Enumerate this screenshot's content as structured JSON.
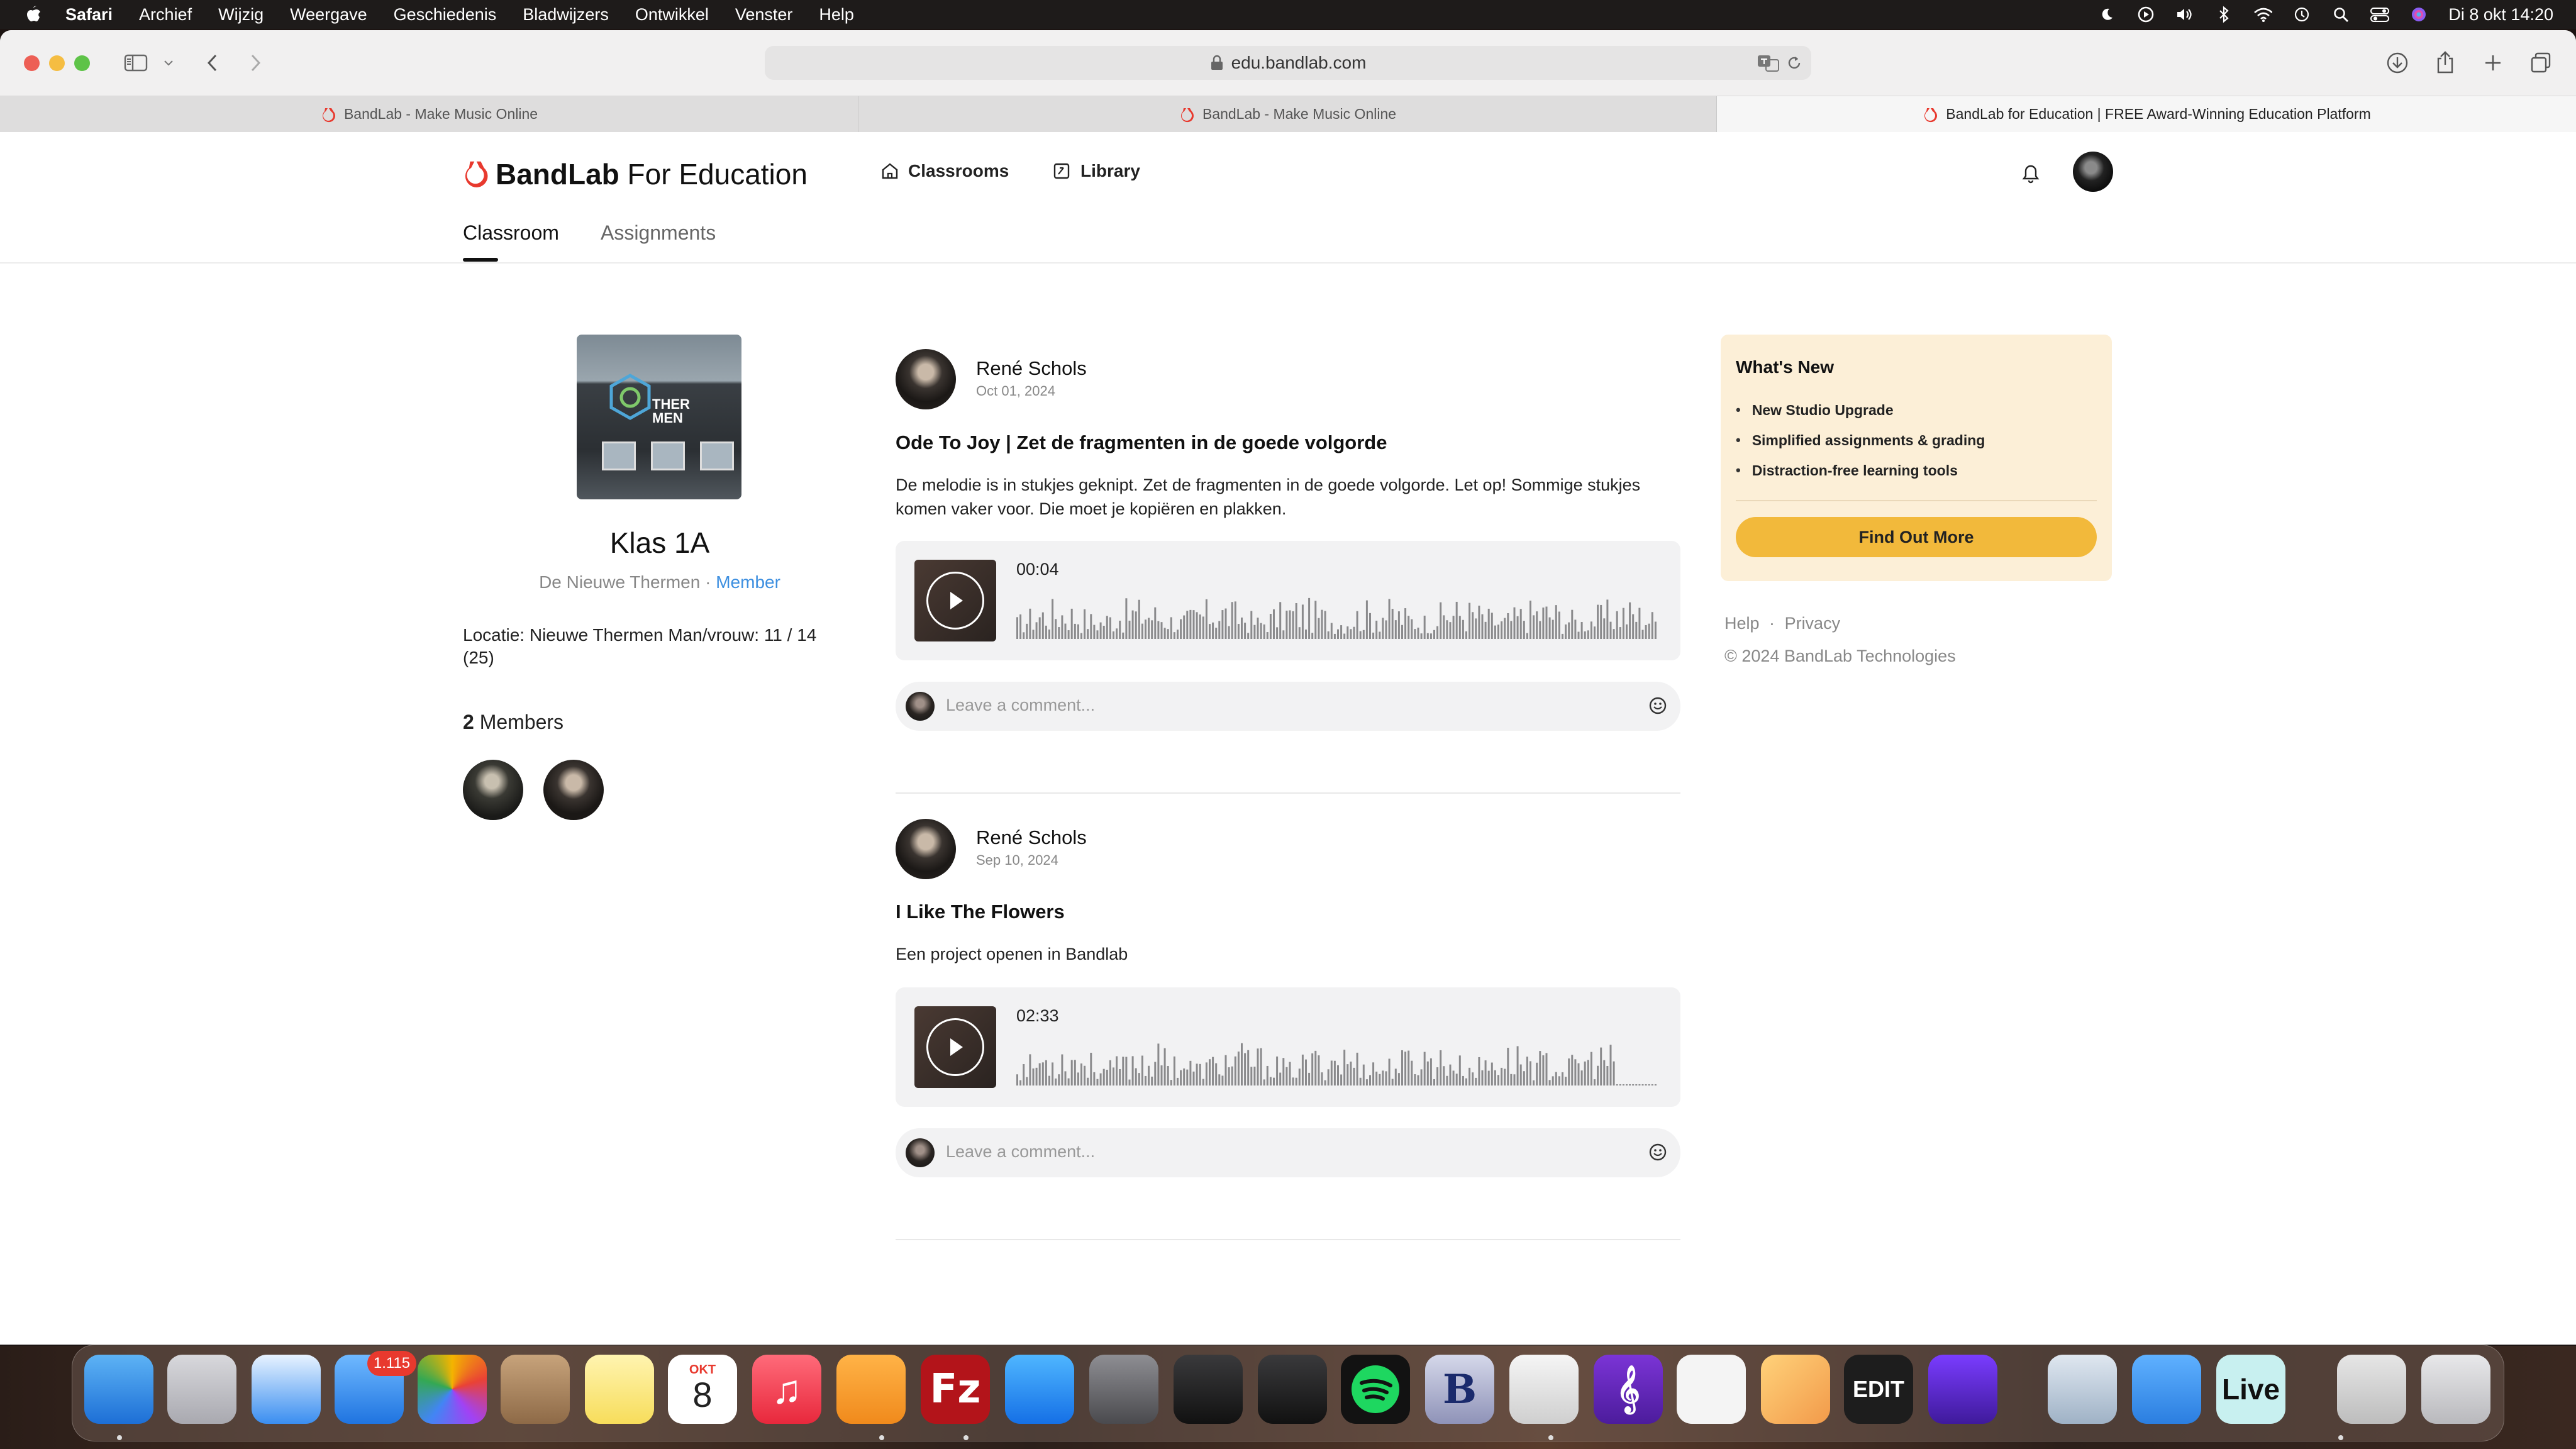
{
  "menubar": {
    "items": [
      "Safari",
      "Archief",
      "Wijzig",
      "Weergave",
      "Geschiedenis",
      "Bladwijzers",
      "Ontwikkel",
      "Venster",
      "Help"
    ],
    "clock": "Di 8 okt  14:20"
  },
  "browser": {
    "url": "edu.bandlab.com",
    "tabs": [
      {
        "title": "BandLab - Make Music Online"
      },
      {
        "title": "BandLab - Make Music Online"
      },
      {
        "title": "BandLab for Education | FREE Award-Winning Education Platform"
      }
    ]
  },
  "site": {
    "brand_main": "BandLab",
    "brand_sub": " For Education",
    "nav": {
      "classrooms": "Classrooms",
      "library": "Library"
    },
    "subtabs": {
      "classroom": "Classroom",
      "assignments": "Assignments"
    },
    "brand_color": "#e8392e"
  },
  "classroom": {
    "image_sign": "THER\nMEN",
    "name": "Klas 1A",
    "school": "De Nieuwe Thermen",
    "separator": " · ",
    "role": "Member",
    "location": "Locatie: Nieuwe Thermen Man/vrouw: 11 / 14 (25)",
    "members_count": "2",
    "members_label": " Members"
  },
  "posts": [
    {
      "author": "René Schols",
      "date": "Oct 01, 2024",
      "title": "Ode To Joy | Zet de fragmenten in de goede volgorde",
      "description": "De melodie is in stukjes geknipt. Zet de fragmenten in de goede volgorde. Let op! Sommige stukjes komen vaker voor. Die moet je kopiëren en plakken.",
      "duration": "00:04",
      "comment_placeholder": "Leave a comment..."
    },
    {
      "author": "René Schols",
      "date": "Sep 10, 2024",
      "title": "I Like The Flowers",
      "description": "Een project openen in Bandlab",
      "duration": "02:33",
      "comment_placeholder": "Leave a comment..."
    }
  ],
  "whats_new": {
    "title": "What's New",
    "items": [
      "New Studio Upgrade",
      "Simplified assignments & grading",
      "Distraction-free learning tools"
    ],
    "button": "Find Out More",
    "accent": "#f2b93b"
  },
  "footer": {
    "help": "Help",
    "sep": "·",
    "privacy": "Privacy",
    "copyright": "© 2024 BandLab Technologies"
  },
  "dock": {
    "mail_badge": "1.115",
    "calendar_month": "OKT",
    "calendar_day": "8",
    "apps": [
      "Finder",
      "Launchpad",
      "Safari",
      "Mail",
      "Photos",
      "Contacts",
      "Notes",
      "Calendar",
      "Music",
      "Pages",
      "FileZilla",
      "App Store",
      "System Settings",
      "Final Cut Pro",
      "Logic Pro",
      "Spotify",
      "BBEdit",
      "TextEdit",
      "MuseScore",
      "Wrap",
      "Pages Helper",
      "X32 Edit",
      "Affinity",
      "Preview",
      "Guitar Pro",
      "Ableton Live",
      "Music Files",
      "Trash"
    ],
    "live_label": "Live",
    "x32_label": "EDIT"
  }
}
